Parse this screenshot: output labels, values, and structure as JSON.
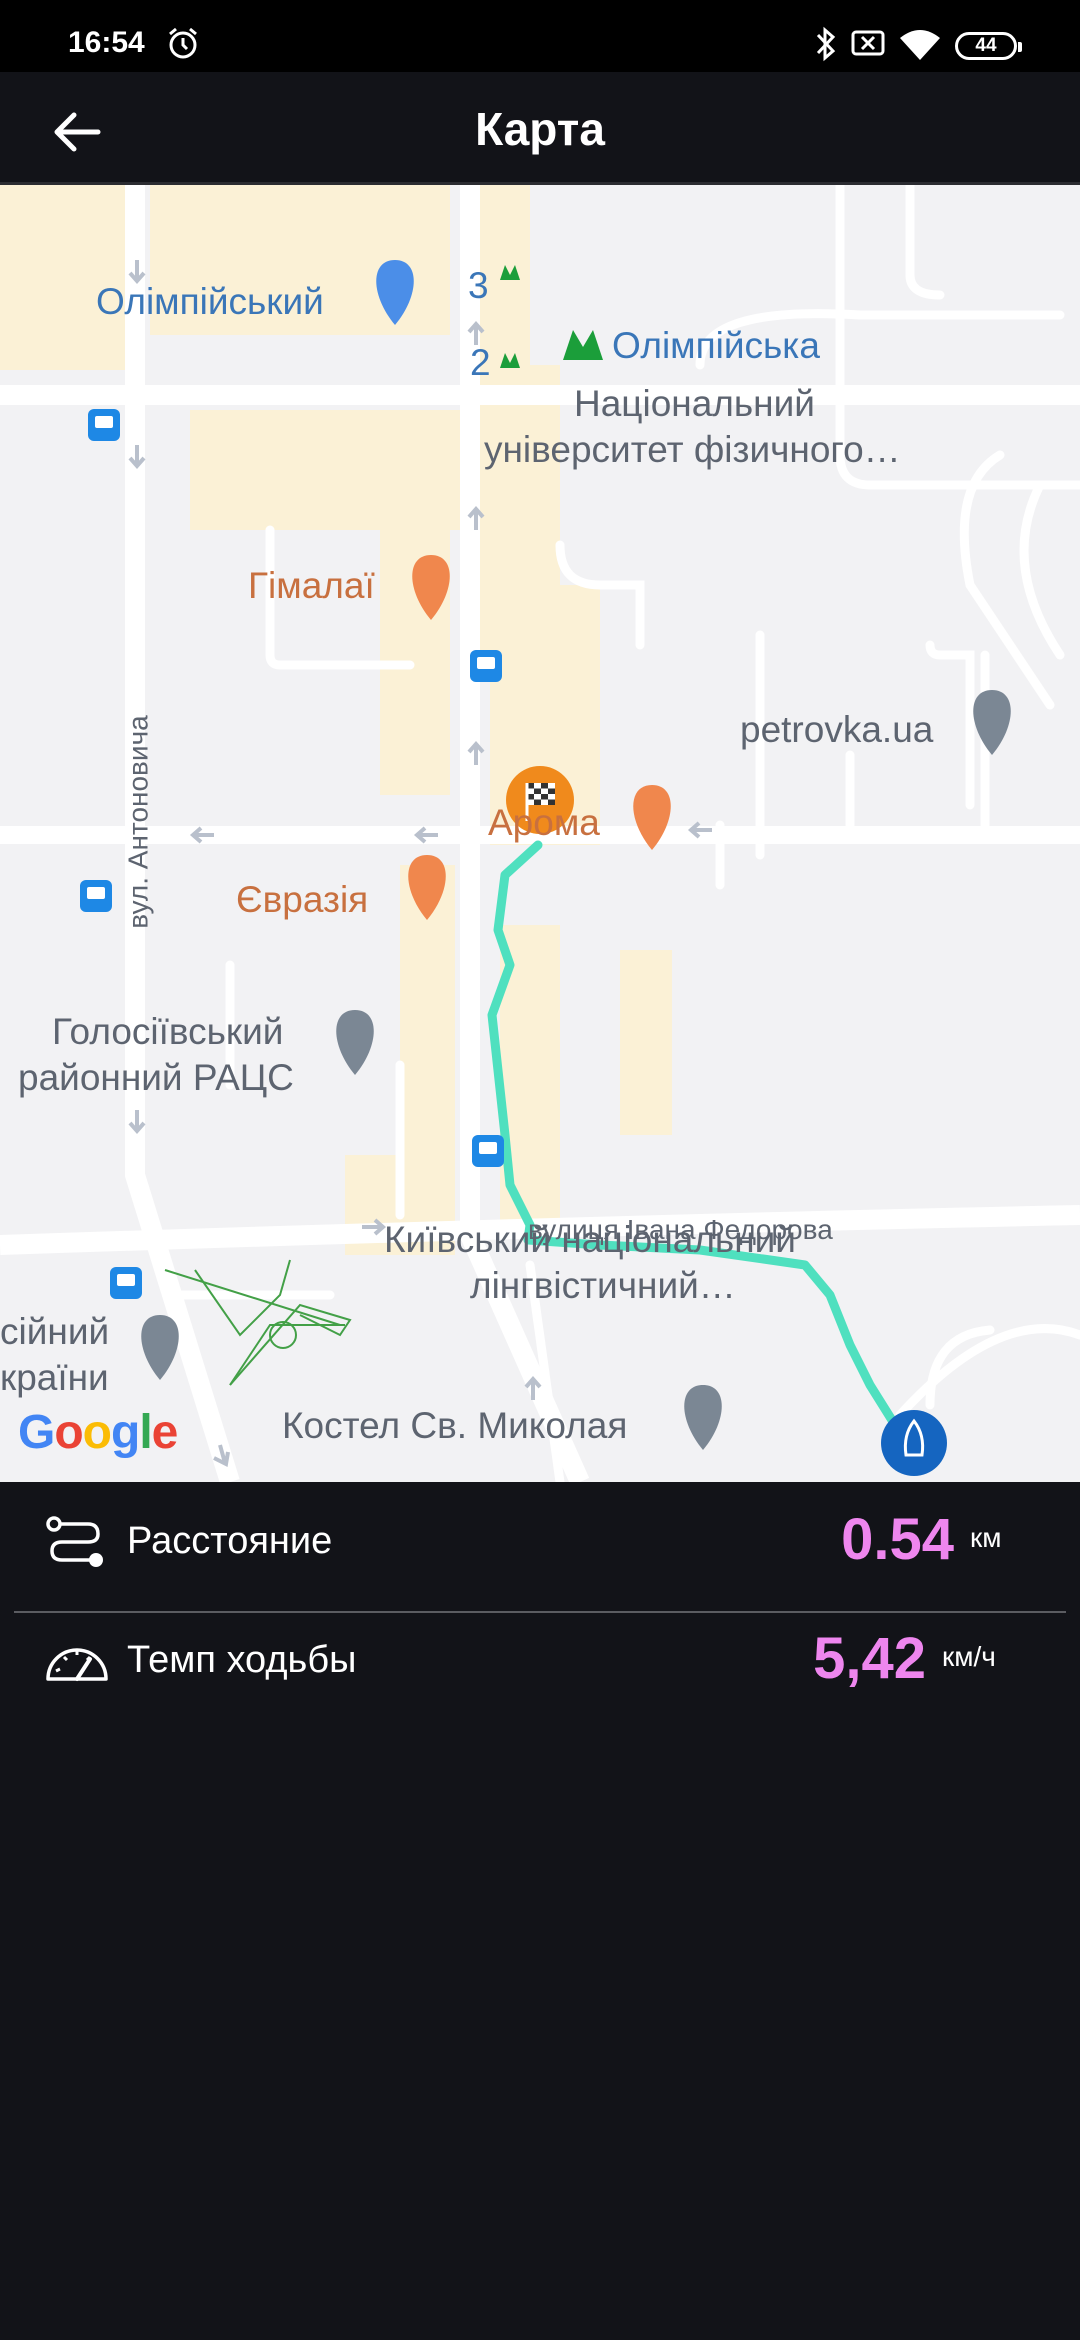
{
  "status_bar": {
    "time": "16:54",
    "battery": "44"
  },
  "app_bar": {
    "title": "Карта"
  },
  "map": {
    "labels": {
      "olimpiyskyi": "Олімпійський",
      "metro_line3": "3",
      "metro_line2": "2",
      "metro_station": "Олімпійська",
      "university_line1": "Національний",
      "university_line2": "університет фізичного…",
      "himalai": "Гімалаї",
      "petrovka": "petrovka.ua",
      "aroma": "Арома",
      "yevrazia": "Євразія",
      "street_antonovycha": "вул. Антоновича",
      "ratss_line1": "Голосіївський",
      "ratss_line2": "районний РАЦС",
      "street_fedorova": "вулиця Івана Федорова",
      "linguistic_line1": "Київський національний",
      "linguistic_line2": "лінгвістичний…",
      "partial_line1": "сійний",
      "partial_line2": "країни",
      "kostel": "Костел Св. Миколая",
      "google": "Google"
    }
  },
  "stats": {
    "distance": {
      "label": "Расстояние",
      "value": "0.54",
      "unit": "км"
    },
    "pace": {
      "label": "Темп ходьбы",
      "value": "5,42",
      "unit": "км/ч"
    }
  },
  "colors": {
    "accent_value": "#ee86ee",
    "route": "#4fe0bf",
    "background": "#121318"
  }
}
